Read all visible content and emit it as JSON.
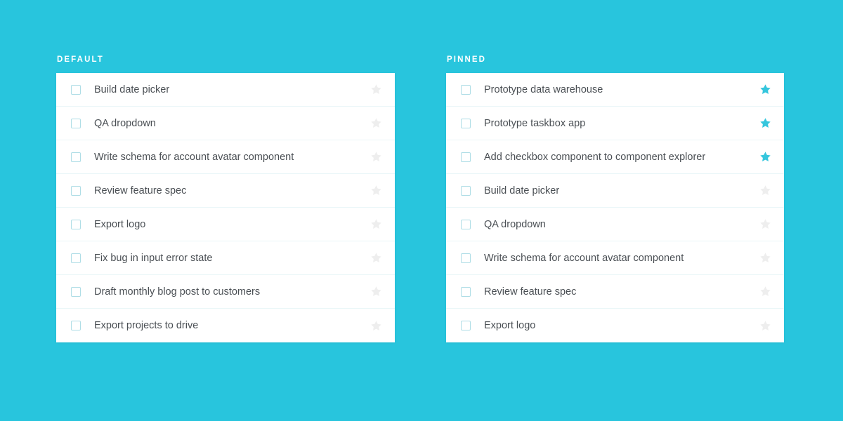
{
  "theme": {
    "background_color": "#28c5dd",
    "card_background": "#ffffff",
    "label_color": "#ffffff",
    "task_text_color": "#4a4f54",
    "divider_color": "#eaf6f8",
    "checkbox_border_color": "#aedde6",
    "star_inactive_color": "#eeeeee",
    "star_active_color": "#35c6dd"
  },
  "columns": [
    {
      "id": "default",
      "label": "DEFAULT",
      "tasks": [
        {
          "label": "Build date picker",
          "checked": false,
          "pinned": false,
          "star_icon": "star-icon"
        },
        {
          "label": "QA dropdown",
          "checked": false,
          "pinned": false,
          "star_icon": "star-icon"
        },
        {
          "label": "Write schema for account avatar component",
          "checked": false,
          "pinned": false,
          "star_icon": "star-icon"
        },
        {
          "label": "Review feature spec",
          "checked": false,
          "pinned": false,
          "star_icon": "star-icon"
        },
        {
          "label": "Export logo",
          "checked": false,
          "pinned": false,
          "star_icon": "star-icon"
        },
        {
          "label": "Fix bug in input error state",
          "checked": false,
          "pinned": false,
          "star_icon": "star-icon"
        },
        {
          "label": "Draft monthly blog post to customers",
          "checked": false,
          "pinned": false,
          "star_icon": "star-icon"
        },
        {
          "label": "Export projects to drive",
          "checked": false,
          "pinned": false,
          "star_icon": "star-icon"
        }
      ]
    },
    {
      "id": "pinned",
      "label": "PINNED",
      "tasks": [
        {
          "label": "Prototype data warehouse",
          "checked": false,
          "pinned": true,
          "star_icon": "star-icon"
        },
        {
          "label": "Prototype taskbox app",
          "checked": false,
          "pinned": true,
          "star_icon": "star-icon"
        },
        {
          "label": "Add checkbox component to component explorer",
          "checked": false,
          "pinned": true,
          "star_icon": "star-icon"
        },
        {
          "label": "Build date picker",
          "checked": false,
          "pinned": false,
          "star_icon": "star-icon"
        },
        {
          "label": "QA dropdown",
          "checked": false,
          "pinned": false,
          "star_icon": "star-icon"
        },
        {
          "label": "Write schema for account avatar component",
          "checked": false,
          "pinned": false,
          "star_icon": "star-icon"
        },
        {
          "label": "Review feature spec",
          "checked": false,
          "pinned": false,
          "star_icon": "star-icon"
        },
        {
          "label": "Export logo",
          "checked": false,
          "pinned": false,
          "star_icon": "star-icon"
        }
      ]
    }
  ]
}
